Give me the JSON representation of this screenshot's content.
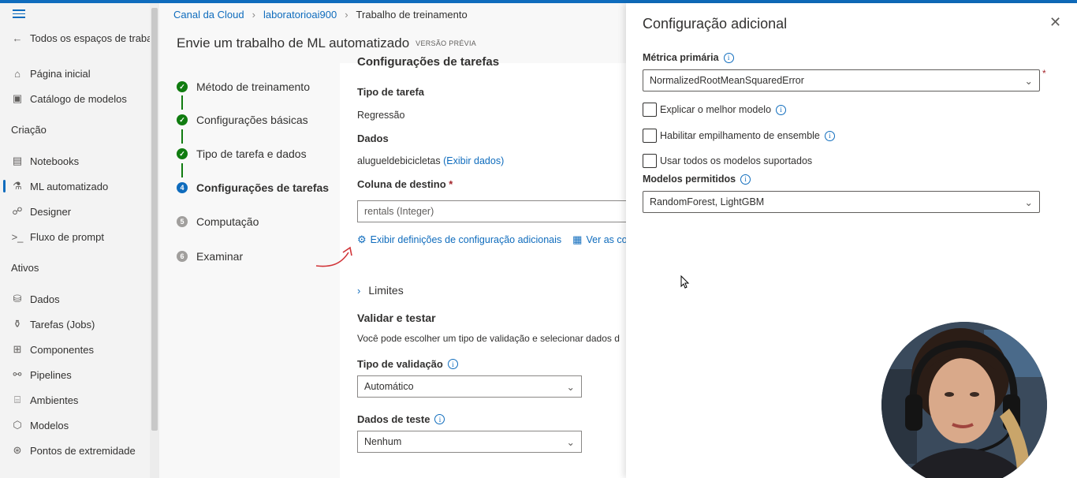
{
  "sidebar": {
    "back_label": "Todos os espaços de trabal",
    "items_top": [
      {
        "label": "Página inicial",
        "icon": "home-icon"
      },
      {
        "label": "Catálogo de modelos",
        "icon": "catalog-icon"
      }
    ],
    "section_creation": "Criação",
    "items_creation": [
      {
        "label": "Notebooks",
        "icon": "notebook-icon"
      },
      {
        "label": "ML automatizado",
        "icon": "automl-icon"
      },
      {
        "label": "Designer",
        "icon": "designer-icon"
      },
      {
        "label": "Fluxo de prompt",
        "icon": "prompt-flow-icon"
      }
    ],
    "section_assets": "Ativos",
    "items_assets": [
      {
        "label": "Dados",
        "icon": "data-icon"
      },
      {
        "label": "Tarefas (Jobs)",
        "icon": "jobs-icon"
      },
      {
        "label": "Componentes",
        "icon": "components-icon"
      },
      {
        "label": "Pipelines",
        "icon": "pipelines-icon"
      },
      {
        "label": "Ambientes",
        "icon": "environments-icon"
      },
      {
        "label": "Modelos",
        "icon": "models-icon"
      },
      {
        "label": "Pontos de extremidade",
        "icon": "endpoints-icon"
      }
    ]
  },
  "breadcrumb": [
    "Canal da Cloud",
    "laboratorioai900",
    "Trabalho de treinamento"
  ],
  "page": {
    "title": "Envie um trabalho de ML automatizado",
    "tag": "VERSÃO PRÉVIA"
  },
  "steps": [
    {
      "num": "1",
      "label": "Método de treinamento",
      "state": "done"
    },
    {
      "num": "2",
      "label": "Configurações básicas",
      "state": "done"
    },
    {
      "num": "3",
      "label": "Tipo de tarefa e dados",
      "state": "done"
    },
    {
      "num": "4",
      "label": "Configurações de tarefas",
      "state": "current"
    },
    {
      "num": "5",
      "label": "Computação",
      "state": "todo"
    },
    {
      "num": "6",
      "label": "Examinar",
      "state": "todo"
    }
  ],
  "content": {
    "section_heading": "Configurações de tarefas",
    "task_type_label": "Tipo de tarefa",
    "task_type_value": "Regressão",
    "data_label": "Dados",
    "data_value": "alugueldebicicletas",
    "data_link": "(Exibir dados)",
    "target_label": "Coluna de destino",
    "target_required": "*",
    "target_value": "rentals (Integer)",
    "action_additional": "Exibir definições de configuração adicionais",
    "action_view": "Ver as cor",
    "limits_label": "Limites",
    "validate_title": "Validar e testar",
    "validate_desc": "Você pode escolher um tipo de validação e selecionar dados d",
    "validation_type_label": "Tipo de validação",
    "validation_type_value": "Automático",
    "test_data_label": "Dados de teste",
    "test_data_value": "Nenhum"
  },
  "panel": {
    "title": "Configuração adicional",
    "primary_metric_label": "Métrica primária",
    "primary_metric_value": "NormalizedRootMeanSquaredError",
    "required_mark": "*",
    "checkbox_explain": "Explicar o melhor modelo",
    "checkbox_ensemble": "Habilitar empilhamento de ensemble",
    "checkbox_all_models": "Usar todos os modelos suportados",
    "allowed_models_label": "Modelos permitidos",
    "allowed_models_value": "RandomForest, LightGBM"
  },
  "colors": {
    "accent": "#0f6cbd",
    "success": "#107c10",
    "required": "#a4262c"
  }
}
